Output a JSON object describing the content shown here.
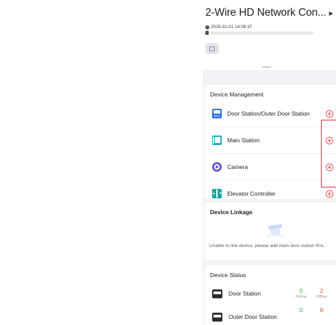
{
  "header": {
    "title": "2-Wire HD Network Con...",
    "datetime": "2025-01-01 14:08:37"
  },
  "device_management": {
    "title": "Device Management",
    "items": [
      {
        "label": "Door Station/Outer Door Station",
        "icon": "door-station-icon"
      },
      {
        "label": "Main Station",
        "icon": "main-station-icon"
      },
      {
        "label": "Camera",
        "icon": "camera-icon"
      },
      {
        "label": "Elevator Controller",
        "icon": "elevator-controller-icon"
      }
    ]
  },
  "device_linkage": {
    "title": "Device Linkage",
    "empty_text": "Unable to link device, please add main door station first."
  },
  "device_status": {
    "title": "Device Status",
    "rows": [
      {
        "label": "Door Station",
        "online": "0",
        "offline": "2",
        "online_label": "Online",
        "offline_label": "Offline"
      },
      {
        "label": "Outer Door Station",
        "online": "0",
        "offline": "0"
      }
    ]
  },
  "colors": {
    "accent_red": "#ef4f4f",
    "online_green": "#2fa84a",
    "highlight_box": "#d93236"
  }
}
